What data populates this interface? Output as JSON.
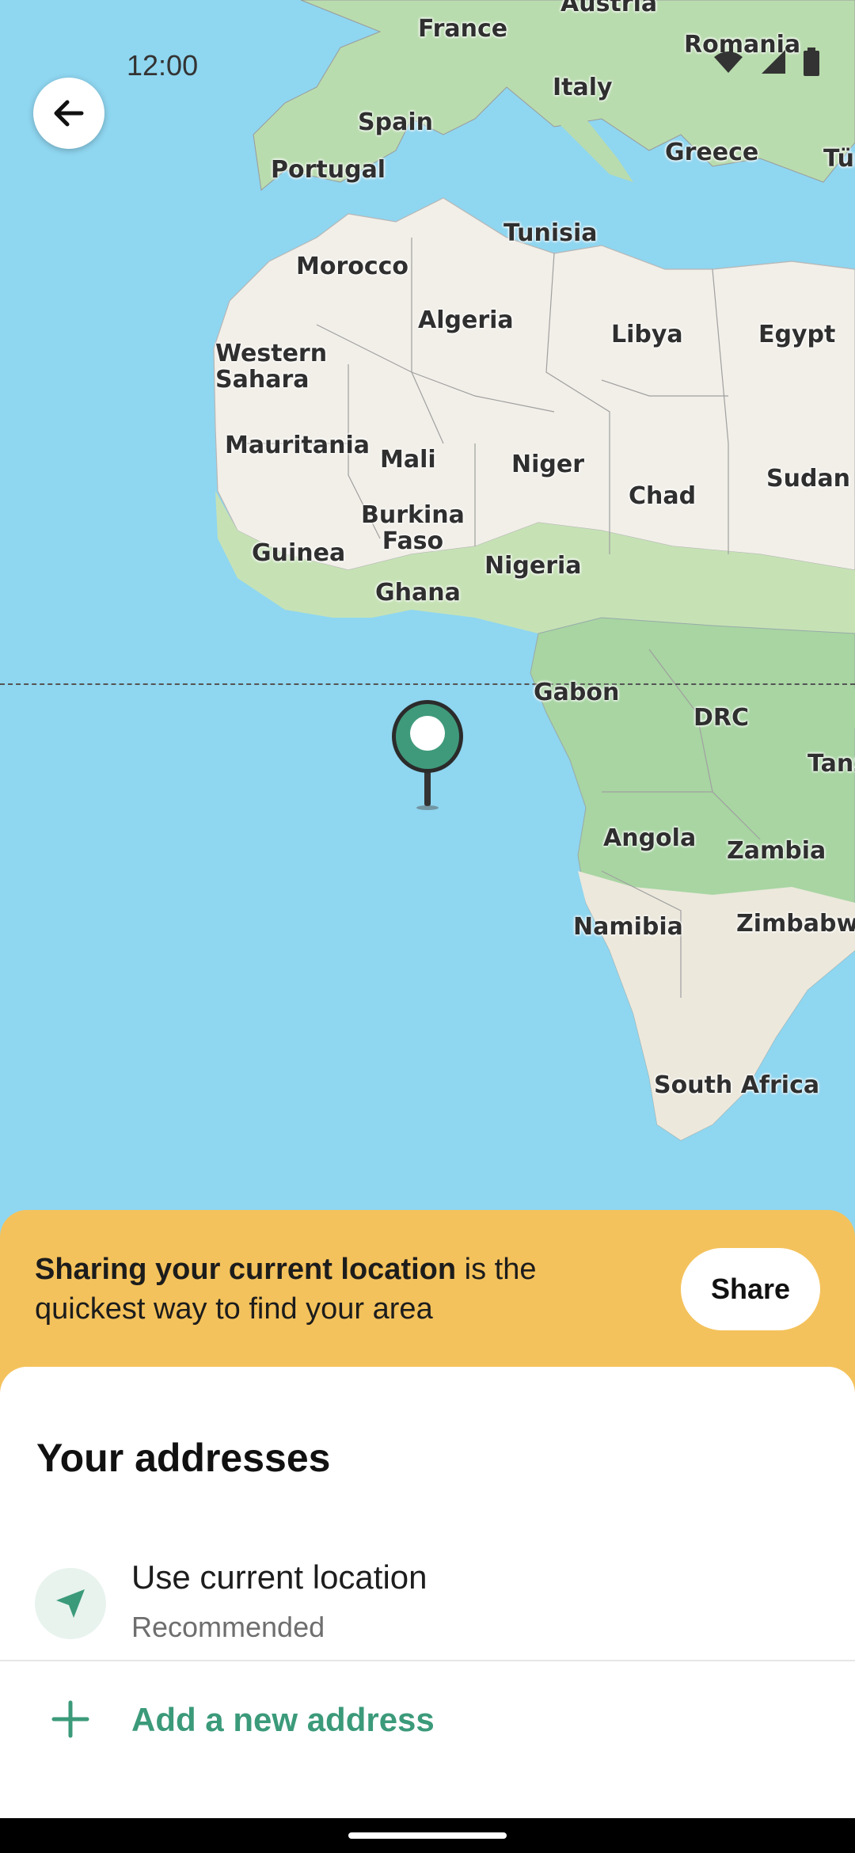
{
  "status_bar": {
    "time": "12:00"
  },
  "map": {
    "labels": {
      "austria": "Austria",
      "france": "France",
      "romania": "Romania",
      "italy": "Italy",
      "spain": "Spain",
      "portugal": "Portugal",
      "greece": "Greece",
      "turkey": "Tür",
      "tunisia": "Tunisia",
      "morocco": "Morocco",
      "algeria": "Algeria",
      "libya": "Libya",
      "egypt": "Egypt",
      "western_sahara": "Western\nSahara",
      "mauritania": "Mauritania",
      "mali": "Mali",
      "niger": "Niger",
      "chad": "Chad",
      "sudan": "Sudan",
      "burkina_faso": "Burkina\nFaso",
      "guinea": "Guinea",
      "nigeria": "Nigeria",
      "ghana": "Ghana",
      "gabon": "Gabon",
      "drc": "DRC",
      "tanzania": "Tanz",
      "angola": "Angola",
      "zambia": "Zambia",
      "namibia": "Namibia",
      "zimbabwe": "Zimbabwe",
      "south_africa": "South Africa"
    }
  },
  "banner": {
    "bold_text": "Sharing your current location",
    "rest_text": " is the quickest way to find your area",
    "share_label": "Share"
  },
  "addresses": {
    "title": "Your addresses",
    "current": {
      "title": "Use current location",
      "subtitle": "Recommended"
    },
    "add_label": "Add a new address"
  },
  "colors": {
    "accent": "#3b9a7a",
    "banner": "#f4c25c",
    "water": "#8fd6f0",
    "land": "#f2efe8",
    "vegetation": "#a8d5a2"
  }
}
